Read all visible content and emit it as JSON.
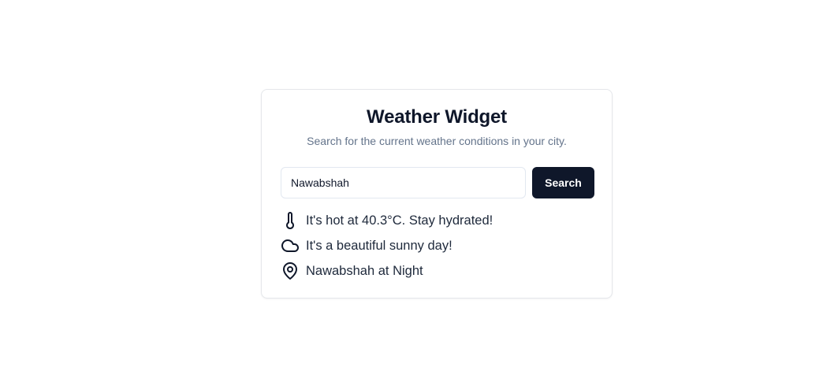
{
  "widget": {
    "title": "Weather Widget",
    "subtitle": "Search for the current weather conditions in your city.",
    "search": {
      "value": "Nawabshah",
      "placeholder": "",
      "button_label": "Search"
    },
    "info": {
      "temperature": {
        "icon": "thermometer-icon",
        "text": "It's hot at 40.3°C. Stay hydrated!"
      },
      "condition": {
        "icon": "cloud-icon",
        "text": "It's a beautiful sunny day!"
      },
      "location": {
        "icon": "map-pin-icon",
        "text": "Nawabshah at Night"
      }
    }
  },
  "colors": {
    "button_bg": "#0f172a",
    "button_text": "#ffffff",
    "title": "#0f172a",
    "subtitle": "#64748b",
    "border": "#e5e7eb"
  }
}
